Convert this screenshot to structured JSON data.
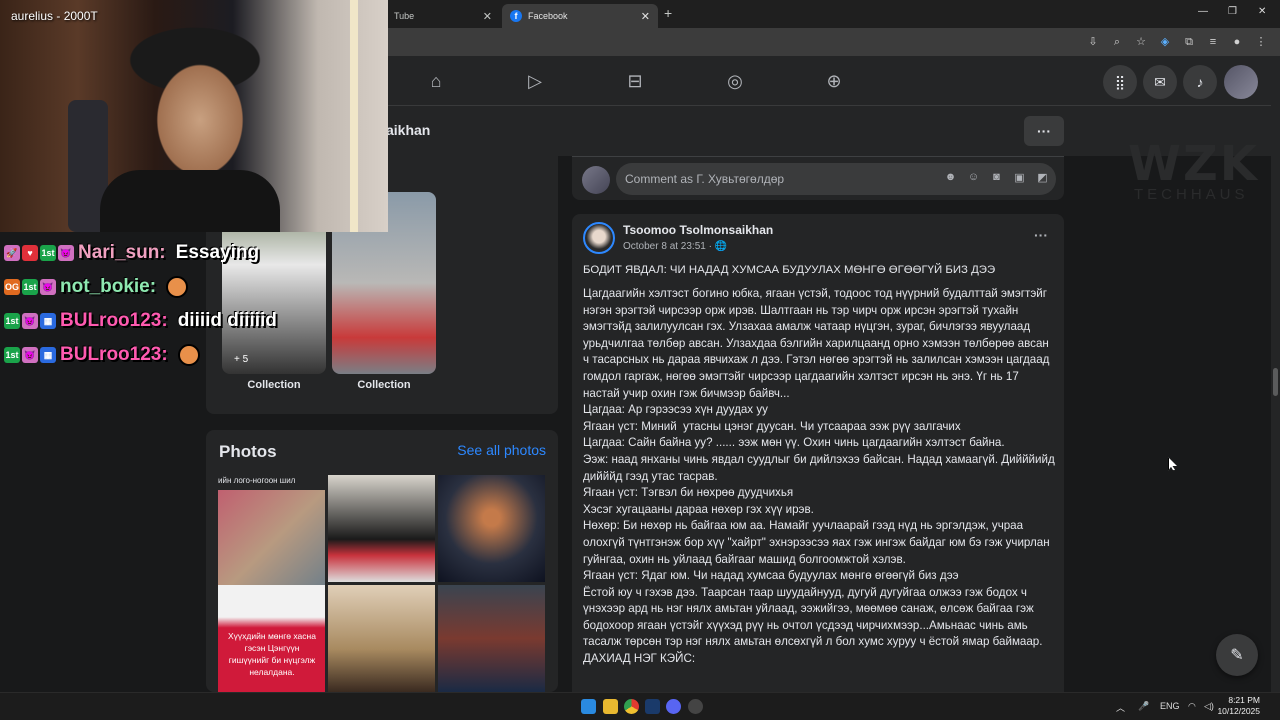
{
  "browser": {
    "tabs": [
      {
        "label": "Tube",
        "active": false
      },
      {
        "label": "Facebook",
        "active": true
      }
    ],
    "new_tab": "+",
    "window_controls": [
      "—",
      "❐",
      "✕"
    ]
  },
  "profile": {
    "name_fragment": "aikhan",
    "more_label": "···"
  },
  "collections": [
    {
      "label": "Collection",
      "overlay": "+ 5"
    },
    {
      "label": "Collection"
    }
  ],
  "photos": {
    "title": "Photos",
    "see_all": "See all photos",
    "caption": "ийн лого-ногоон шил",
    "tile4_text": "Хүүхдийн мөнгө хасна гэсэн Цэнгүүн гишүүнийг би нүцгэлж нелалдана."
  },
  "comment_box": {
    "placeholder": "Comment as Г. Хувьтөгөлдөр"
  },
  "post": {
    "author": "Tsoomoo Tsolmonsaikhan",
    "date": "October 8 at 23:51 · ",
    "more": "···",
    "title": "БОДИТ ЯВДАЛ: ЧИ НАДАД ХУМСАА БУДУУЛАХ МӨНГӨ ӨГӨӨГҮЙ БИЗ ДЭЭ",
    "body": "Цагдаагийн хэлтэст богино юбка, ягаан үстэй, тодоос тод нүүрний будалттай эмэгтэйг нэгэн эрэгтэй чирсээр орж ирэв. Шалтгаан нь тэр чирч орж ирсэн эрэгтэй тухайн эмэгтэйд залилуулсан гэх. Улзахаа амалж чатаар нүцгэн, зураг, бичлэгээ явуулаад урьдчилгаа төлбөр авсан. Улзахдаа бэлгийн харилцаанд орно хэмээн төлбөрөө авсан ч тасарсных нь дараа явчихаж л дээ. Гэтэл нөгөө эрэгтэй нь залилсан хэмээн цагдаад гомдол гаргаж, нөгөө эмэгтэйг чирсээр цагдаагийн хэлтэст ирсэн нь энэ. Үг нь 17 настай учир охин гэж бичмээр байвч...\nЦагдаа: Ар гэрээсээ хүн дуудах уу\nЯгаан үст: Миний  утасны цэнэг дуусан. Чи утсаараа ээж рүү залгачих\nЦагдаа: Сайн байна уу? ...... ээж мөн үү. Охин чинь цагдаагийн хэлтэст байна.\nЭэж: наад янханы чинь явдал суудлыг би дийлэхээ байсан. Надад хамаагүй. Дийййийд дийййд гээд утас тасрав.\nЯгаан үст: Тэгвэл би нөхрөө дуудчихья\nХэсэг хугацааны дараа нөхөр гэх хүү ирэв.\nНөхөр: Би нөхөр нь байгаа юм аа. Намайг уучлаарай гээд нүд нь эргэлдэж, учраа олохгүй түнтгэнэж бор хүү \"хайрт\" эхнэрээсээ яах гэж ингэж байдаг юм бэ гэж учирлан гуйнгаа, охин нь уйлаад байгааг машид болгоомжтой хэлэв.\nЯгаан үст: Ядаг юм. Чи надад хумсаа будуулах мөнгө өгөөгүй биз дээ\nЁстой юу ч гэхэв дээ. Таарсан таар шуудайнууд, дугуй дугуйгаа олжээ гэж бодох ч үнэхээр ард нь нэг нялх амьтан уйлаад, ээжийгээ, мөөмөө санаж, өлсөж байгаа гэж бодохоор ягаан үстэйг хүүхэд рүү нь очтол үсдээд чирчихмээр...Амьнаас чинь амь тасалж төрсөн тэр нэг нялх амьтан өлсөхгүй л бол хумс хуруу ч ёстой ямар баймаар.\nДАХИАД НЭГ КЭЙС:"
  },
  "watermark": {
    "main": "WZK",
    "sub": "TECHHAUS"
  },
  "stream": {
    "cam_user": "aurelius - 2000T",
    "chat": [
      {
        "name": "Nari_sun:",
        "name_color": "#f0a0c0",
        "msg": "Essaying",
        "badges": [
          "🚀",
          "♥",
          "1st",
          "👿"
        ]
      },
      {
        "name": "not_bokie:",
        "name_color": "#8ee8b0",
        "msg": "",
        "badges": [
          "OG",
          "1st",
          "👿"
        ]
      },
      {
        "name": "BULroo123:",
        "name_color": "#ff5ab0",
        "msg": "diiiid diiiiid",
        "badges": [
          "1st",
          "👿",
          "▦"
        ]
      },
      {
        "name": "BULroo123:",
        "name_color": "#ff5ab0",
        "msg": "",
        "badges": [
          "1st",
          "👿",
          "▦"
        ]
      }
    ]
  },
  "taskbar": {
    "lang": "ENG",
    "time": "8:21 PM",
    "date": "10/12/2025"
  }
}
